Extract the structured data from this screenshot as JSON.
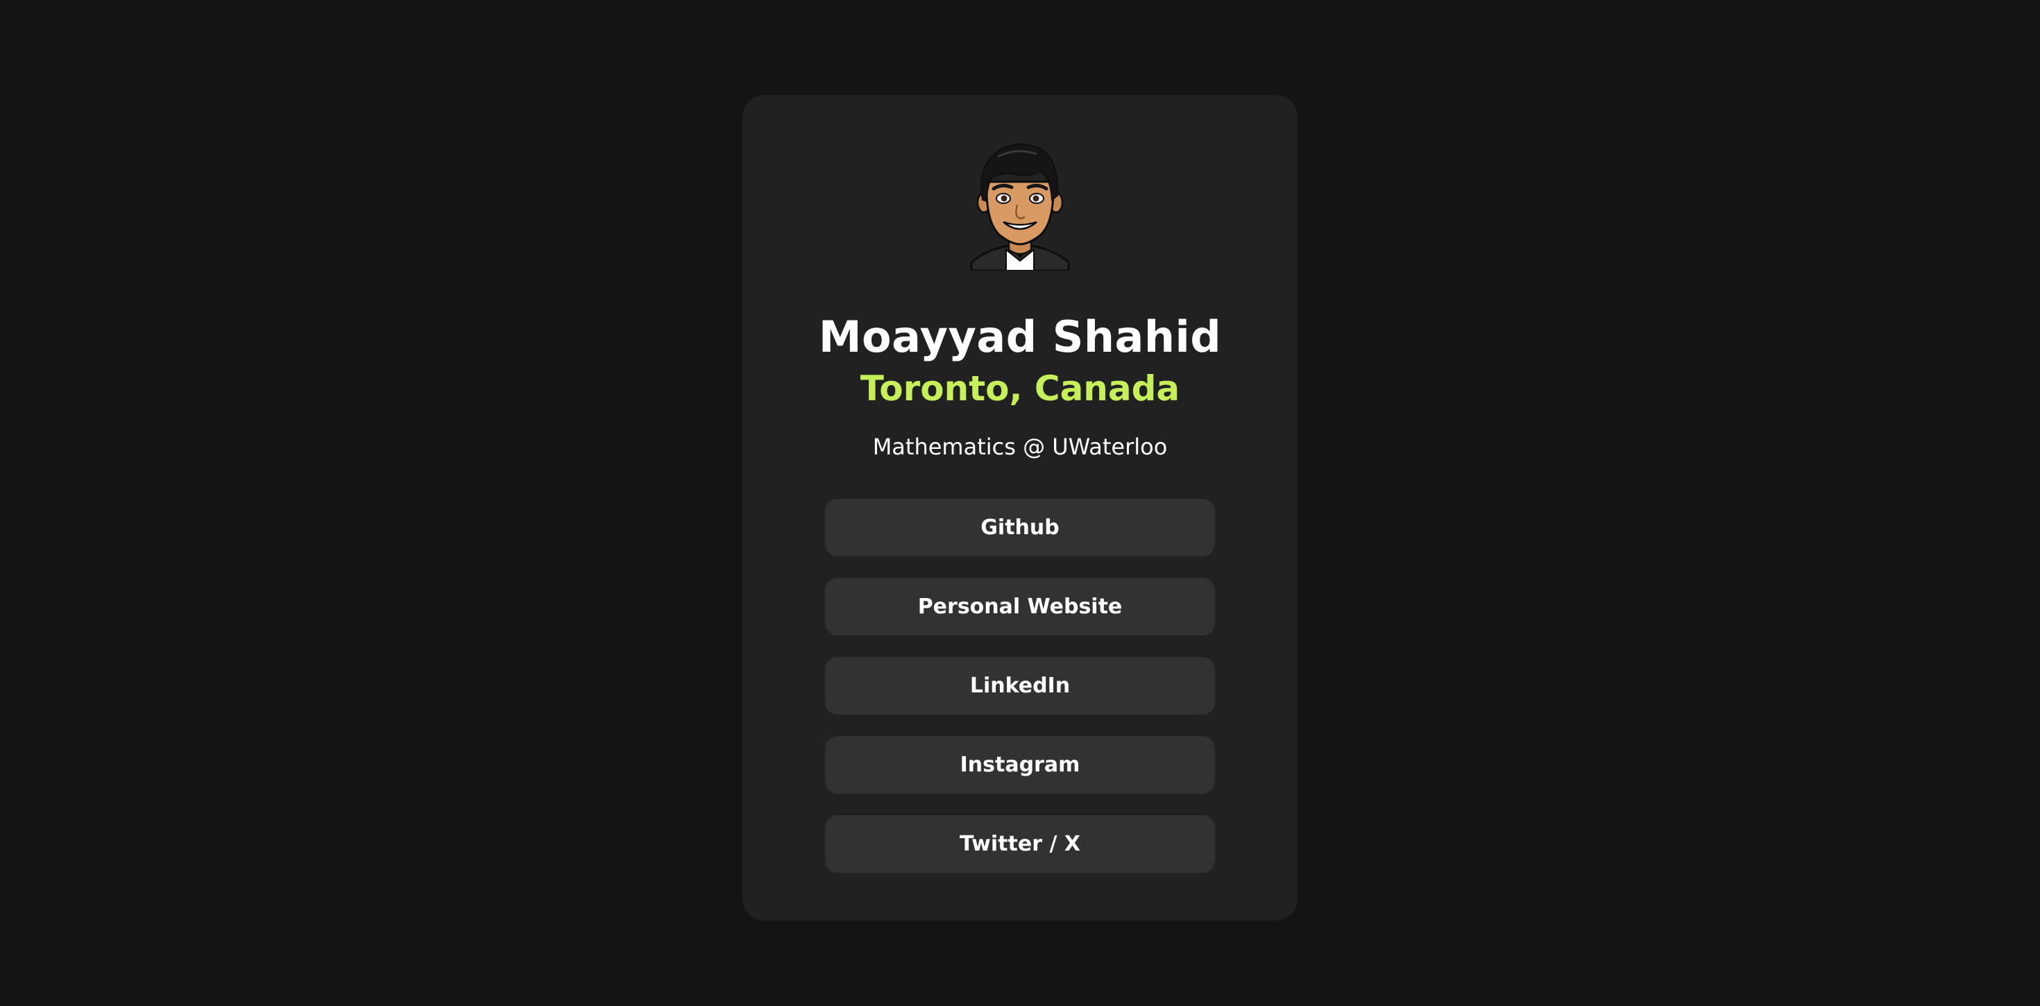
{
  "profile": {
    "name": "Moayyad Shahid",
    "location": "Toronto, Canada",
    "tagline": "Mathematics @ UWaterloo",
    "avatar_icon": "cartoon-avatar"
  },
  "links": [
    {
      "label": "Github"
    },
    {
      "label": "Personal Website"
    },
    {
      "label": "LinkedIn"
    },
    {
      "label": "Instagram"
    },
    {
      "label": "Twitter / X"
    }
  ],
  "colors": {
    "page_background": "#141414",
    "card_background": "#212121",
    "button_background": "#323232",
    "accent": "#c6f05a",
    "text": "#ffffff"
  }
}
